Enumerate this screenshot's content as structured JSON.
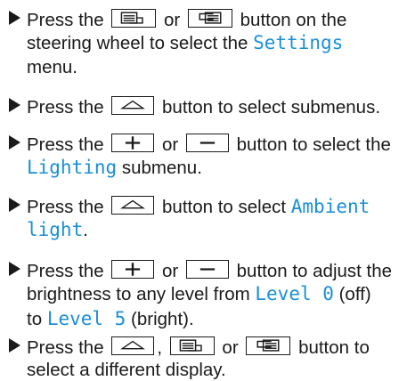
{
  "steps": [
    {
      "lines": [
        {
          "a": "Press the",
          "b": "or",
          "c": "button on the"
        },
        {
          "a": "steering wheel to select the",
          "term": "Settings"
        },
        {
          "a": "menu."
        }
      ],
      "buttons": [
        "display-back-button",
        "display-forward-button"
      ]
    },
    {
      "lines": [
        {
          "a": "Press the",
          "b": "button to select submenus."
        }
      ],
      "buttons": [
        "submenu-up-button"
      ]
    },
    {
      "lines": [
        {
          "a": "Press the",
          "b": "or",
          "c": "button to select the"
        },
        {
          "term": "Lighting",
          "d": "submenu."
        }
      ],
      "buttons": [
        "plus-button",
        "minus-button"
      ]
    },
    {
      "lines": [
        {
          "a": "Press the",
          "b": "button to select",
          "term": "Ambient"
        },
        {
          "term": "light",
          "d": "."
        }
      ],
      "buttons": [
        "submenu-up-button"
      ]
    },
    {
      "lines": [
        {
          "a": "Press the",
          "b": "or",
          "c": "button to adjust the"
        },
        {
          "a": "brightness to any level from",
          "term": "Level 0",
          "d": "(off)"
        },
        {
          "a": "to",
          "term": "Level 5",
          "d": "(bright)."
        }
      ],
      "buttons": [
        "plus-button",
        "minus-button"
      ]
    },
    {
      "lines": [
        {
          "a": "Press the",
          "b": ",",
          "c": "or",
          "d": "button to"
        },
        {
          "a": "select a different display."
        }
      ],
      "buttons": [
        "submenu-up-button",
        "display-back-button",
        "display-forward-button"
      ]
    }
  ],
  "icons": [
    "bullet-triangle-icon",
    "display-back-icon",
    "display-forward-icon",
    "submenu-up-icon",
    "plus-icon",
    "minus-icon"
  ],
  "colors": {
    "text": "#1a1a1a",
    "term": "#1a8fd6"
  }
}
